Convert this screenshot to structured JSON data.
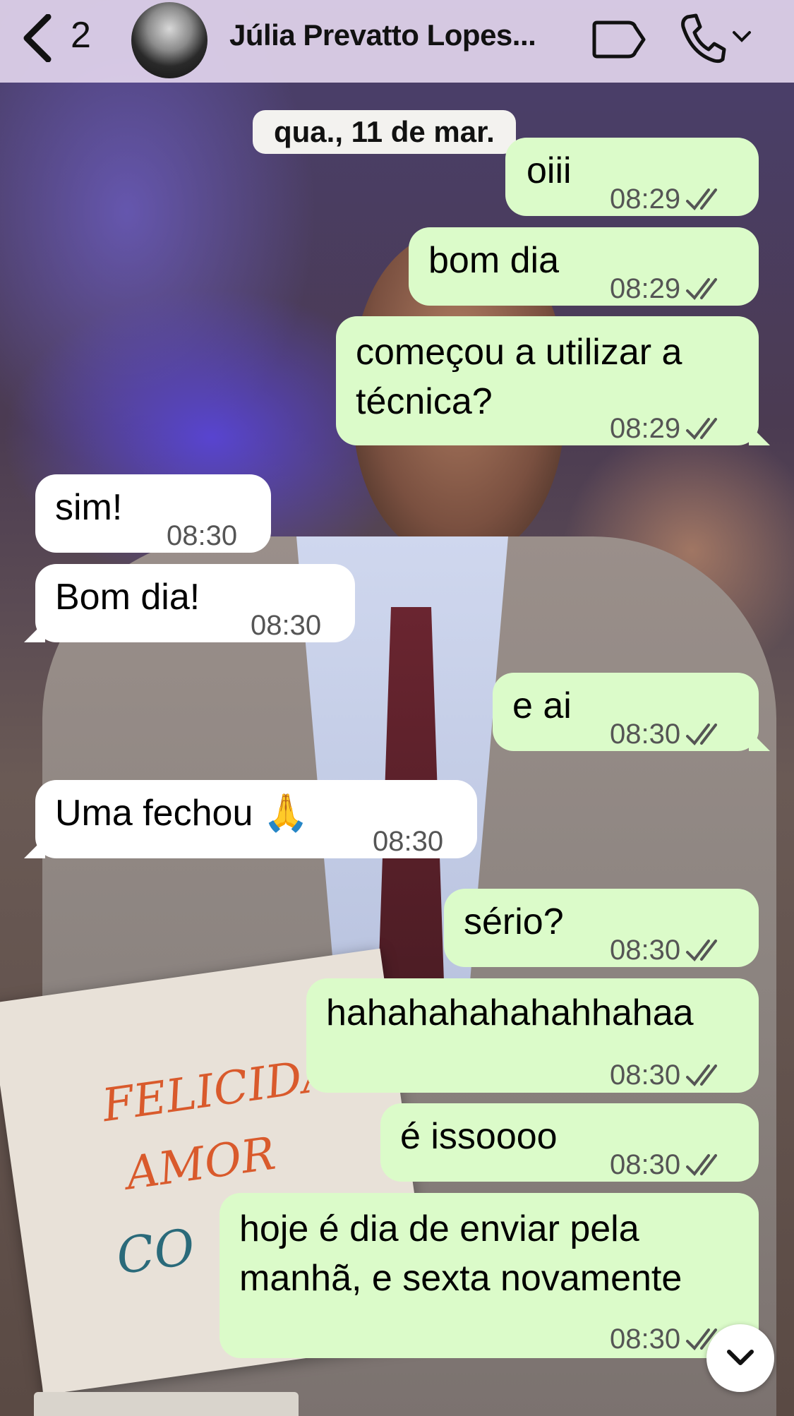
{
  "header": {
    "unread_count": "2",
    "contact_name": "Júlia Prevatto Lopes..."
  },
  "date_separator": "qua., 11 de mar.",
  "messages": [
    {
      "dir": "out",
      "text": "oiii",
      "time": "08:29",
      "status": "read"
    },
    {
      "dir": "out",
      "text": "bom dia",
      "time": "08:29",
      "status": "read"
    },
    {
      "dir": "out",
      "text_line1": "começou a utilizar a",
      "text_line2": "técnica?",
      "time": "08:29",
      "status": "read"
    },
    {
      "dir": "in",
      "text": "sim!",
      "time": "08:30"
    },
    {
      "dir": "in",
      "text": "Bom dia!",
      "time": "08:30"
    },
    {
      "dir": "out",
      "text": "e ai",
      "time": "08:30",
      "status": "read"
    },
    {
      "dir": "in",
      "text": "Uma fechou 🙏",
      "time": "08:30"
    },
    {
      "dir": "out",
      "text": "sério?",
      "time": "08:30",
      "status": "read"
    },
    {
      "dir": "out",
      "text": "hahahahahahahhahaa",
      "time": "08:30",
      "status": "read"
    },
    {
      "dir": "out",
      "text": "é issoooo",
      "time": "08:30",
      "status": "read"
    },
    {
      "dir": "out",
      "text_line1": "hoje é dia de enviar pela",
      "text_line2": "manhã, e sexta novamente",
      "time": "08:30",
      "status": "read"
    }
  ],
  "background_sign": {
    "line1": "FELICIDADE",
    "line2": "AMOR",
    "line3": "CO"
  },
  "colors": {
    "header_bg": "#e1d4ec",
    "outgoing_bubble": "#dbfbc9",
    "incoming_bubble": "#ffffff",
    "timestamp": "#555555"
  },
  "icons": [
    "chevron-left-icon",
    "video-camera-icon",
    "phone-icon",
    "chevron-down-icon",
    "double-check-icon",
    "scroll-down-icon"
  ]
}
